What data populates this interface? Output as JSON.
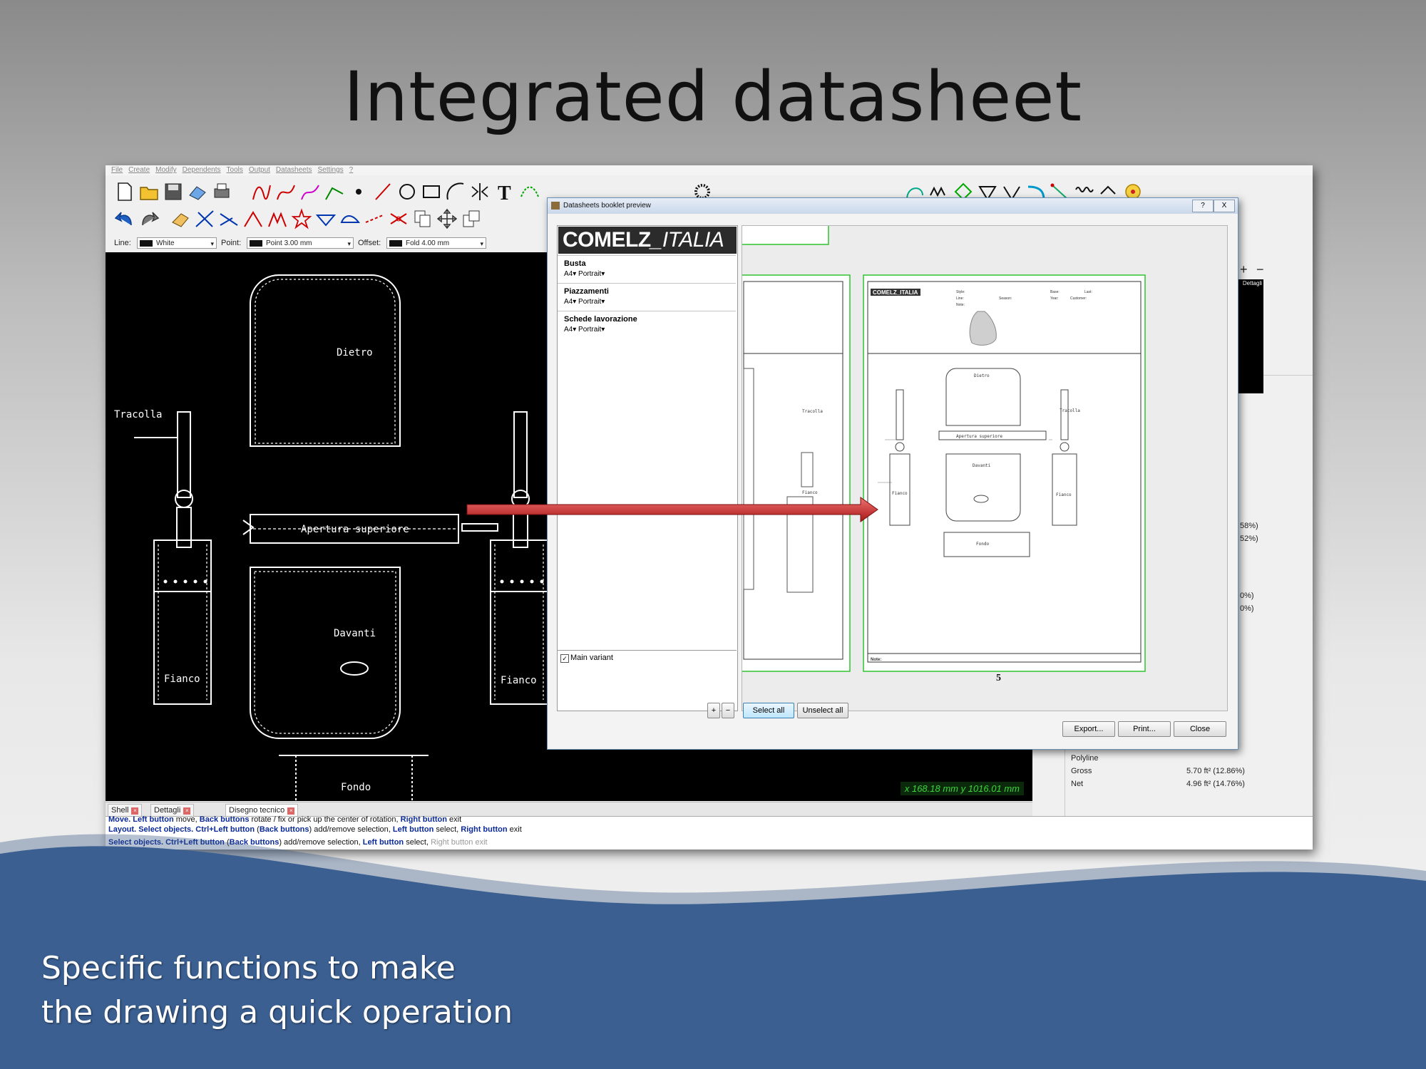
{
  "slide": {
    "title": "Integrated datasheet",
    "caption_line1": "Specific functions to make",
    "caption_line2": "the drawing a quick operation"
  },
  "menu": [
    "File",
    "Create",
    "Modify",
    "Dependents",
    "Tools",
    "Output",
    "Datasheets",
    "Settings",
    "?"
  ],
  "options_bar": {
    "line_label": "Line:",
    "line_value": "White",
    "point_label": "Point:",
    "point_value": "Point 3.00 mm",
    "offset_label": "Offset:",
    "offset_value": "Fold 4.00 mm"
  },
  "canvas": {
    "pieces": {
      "dietro": "Dietro",
      "tracolla": "Tracolla",
      "apertura": "Apertura superiore",
      "davanti": "Davanti",
      "fianco_left": "Fianco",
      "fianco_right": "Fianco",
      "fondo": "Fondo"
    },
    "coordinates": "x 168.18 mm  y 1016.01 mm"
  },
  "tabs": [
    "Shell",
    "Dettagli",
    "Disegno tecnico"
  ],
  "status": {
    "line1_bold1": "Move.",
    "line1_b1": "Left button",
    "line1_t1": " move, ",
    "line1_b2": "Back buttons",
    "line1_t2": " rotate / fix or pick up the center of rotation, ",
    "line1_b3": "Right button",
    "line1_t3": " exit",
    "line2_bold1": "Layout.",
    "line2_bold2": "Select objects.",
    "line2_b1": "Ctrl+Left button",
    "line2_t1": " (",
    "line2_b2": "Back buttons",
    "line2_t2": ") add/remove selection, ",
    "line2_b3": "Left button",
    "line2_t3": " select, ",
    "line2_b4": "Right button",
    "line2_t4": " exit",
    "line3_bold1": "Select objects.",
    "line3_b1": "Ctrl+Left button",
    "line3_t1": " (",
    "line3_b2": "Back buttons",
    "line3_t2": ") add/remove selection, ",
    "line3_b3": "Left button",
    "line3_t3": " select, ",
    "line3_t4": "Right button",
    "line3_t5": "exit"
  },
  "properties": {
    "pct1": "58%)",
    "pct2": "52%)",
    "pct3": "0%)",
    "pct4": "0%)",
    "type": "Polyline",
    "gross_label": "Gross",
    "gross_value": "5.70 ft² (12.86%)",
    "net_label": "Net",
    "net_value": "4.96 ft² (14.76%)",
    "preview_label": "Dettagli"
  },
  "dialog": {
    "title": "Datasheets booklet preview",
    "help_btn": "?",
    "close_x": "X",
    "logo_main": "COMELZ",
    "logo_italic": "_ITALIA",
    "sections": [
      {
        "name": "Busta",
        "format": "A4▾  Portrait▾"
      },
      {
        "name": "Piazzamenti",
        "format": "A4▾  Portrait▾"
      },
      {
        "name": "Schede lavorazione",
        "format": "A4▾  Portrait▾"
      }
    ],
    "main_variant": "Main variant",
    "select_all": "Select all",
    "unselect_all": "Unselect all",
    "export": "Export...",
    "print": "Print...",
    "close": "Close",
    "page_number": "5",
    "sheet": {
      "logo": "COMELZ_ITALIA",
      "style_label": "Style:",
      "line_label": "Line:",
      "note_label": "Note:",
      "base_label": "Base:",
      "year_label": "Year:",
      "season_label": "Season:",
      "last_label": "Last:",
      "customer_label": "Customer:",
      "note_footer": "Note:",
      "dietro": "Dietro",
      "tracolla_l": "Tracolla",
      "tracolla_r": "Tracolla",
      "apertura": "Apertura superiore",
      "davanti": "Davanti",
      "fianco_l": "Fianco",
      "fianco_r": "Fianco",
      "fondo": "Fondo"
    }
  }
}
